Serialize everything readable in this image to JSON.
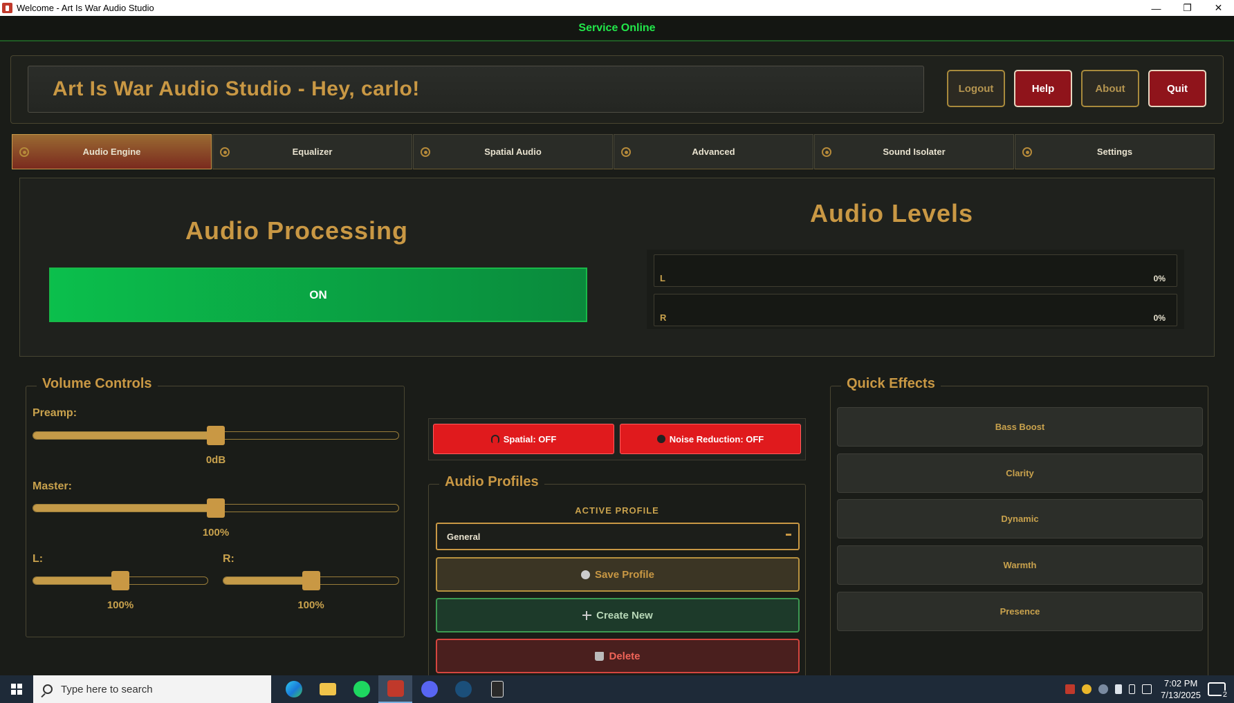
{
  "window": {
    "title": "Welcome - Art Is War Audio Studio",
    "min": "—",
    "restore": "❐",
    "close": "✕"
  },
  "status": {
    "text": "Service Online",
    "color": "#22e64a"
  },
  "header": {
    "title": "Art Is War Audio Studio - Hey, carlo!",
    "buttons": {
      "logout": "Logout",
      "help": "Help",
      "about": "About",
      "quit": "Quit"
    }
  },
  "tabs": [
    {
      "label": "Audio Engine",
      "active": true
    },
    {
      "label": "Equalizer"
    },
    {
      "label": "Spatial Audio"
    },
    {
      "label": "Advanced"
    },
    {
      "label": "Sound Isolater"
    },
    {
      "label": "Settings"
    }
  ],
  "engine": {
    "processing_title": "Audio Processing",
    "processing_state": "ON",
    "levels_title": "Audio Levels",
    "levels": [
      {
        "channel": "L",
        "value": "0%"
      },
      {
        "channel": "R",
        "value": "0%"
      }
    ]
  },
  "volume": {
    "title": "Volume Controls",
    "preamp": {
      "label": "Preamp:",
      "value": "0dB",
      "position": 0.5
    },
    "master": {
      "label": "Master:",
      "value": "100%",
      "position": 0.5
    },
    "left": {
      "label": "L:",
      "value": "100%",
      "position": 0.5
    },
    "right": {
      "label": "R:",
      "value": "100%",
      "position": 0.5
    }
  },
  "toggles": {
    "spatial": "Spatial: OFF",
    "noise": "Noise Reduction: OFF"
  },
  "profiles": {
    "title": "Audio Profiles",
    "active_label": "ACTIVE PROFILE",
    "selected": "General",
    "save": "Save Profile",
    "create": "Create New",
    "delete": "Delete"
  },
  "quick_effects": {
    "title": "Quick Effects",
    "items": [
      "Bass Boost",
      "Clarity",
      "Dynamic",
      "Warmth",
      "Presence"
    ]
  },
  "taskbar": {
    "search_placeholder": "Type here to search",
    "time": "7:02 PM",
    "date": "7/13/2025",
    "notifications": "2"
  },
  "colors": {
    "accent": "#c99844",
    "on": "#0bbf4c",
    "danger": "#e01a1d"
  }
}
